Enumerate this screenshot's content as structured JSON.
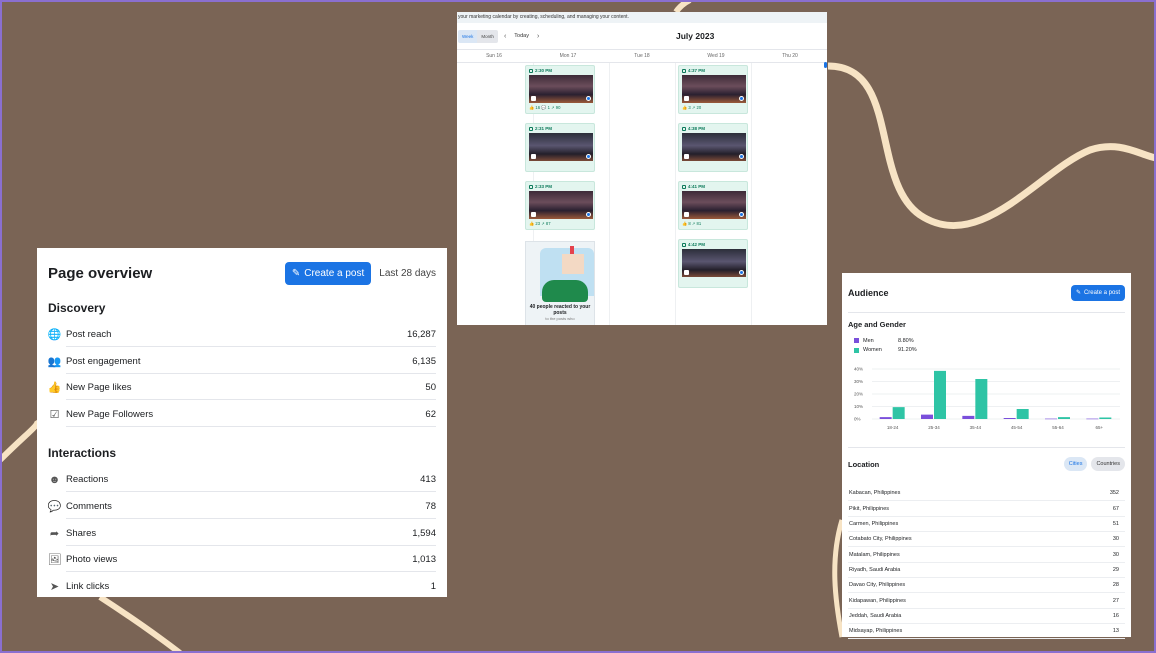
{
  "colors": {
    "background": "#7a6455",
    "accent": "#1b74e4",
    "men": "#7a4fdb",
    "women": "#2ec4a5",
    "post_green": "#0c7a5a"
  },
  "overview": {
    "title": "Page overview",
    "create_post_label": "Create a post",
    "date_range": "Last 28 days",
    "discovery": {
      "heading": "Discovery",
      "rows": [
        {
          "icon": "globe-icon",
          "label": "Post reach",
          "value": "16,287"
        },
        {
          "icon": "people-icon",
          "label": "Post engagement",
          "value": "6,135"
        },
        {
          "icon": "thumbs-up-icon",
          "label": "New Page likes",
          "value": "50"
        },
        {
          "icon": "check-box-icon",
          "label": "New Page Followers",
          "value": "62"
        }
      ]
    },
    "interactions": {
      "heading": "Interactions",
      "rows": [
        {
          "icon": "smiley-icon",
          "label": "Reactions",
          "value": "413"
        },
        {
          "icon": "comment-icon",
          "label": "Comments",
          "value": "78"
        },
        {
          "icon": "share-icon",
          "label": "Shares",
          "value": "1,594"
        },
        {
          "icon": "photo-icon",
          "label": "Photo views",
          "value": "1,013"
        },
        {
          "icon": "cursor-icon",
          "label": "Link clicks",
          "value": "1"
        }
      ]
    }
  },
  "calendar": {
    "banner": "your marketing calendar by creating, scheduling, and managing your content.",
    "view_week": "Week",
    "view_month": "Month",
    "today_label": "Today",
    "month_title": "July 2023",
    "days": [
      "Sun 16",
      "Mon 17",
      "Tue 18",
      "Wed 19",
      "Thu 20"
    ],
    "mon_posts": [
      {
        "time": "2:30 PM",
        "stats": "👍 16  💬 1  ↗ 90"
      },
      {
        "time": "2:31 PM",
        "stats": ""
      },
      {
        "time": "2:33 PM",
        "stats": "👍 23  ↗ 87"
      }
    ],
    "wed_posts": [
      {
        "time": "4:37 PM",
        "stats": "👍 3  ↗ 20"
      },
      {
        "time": "4:38 PM",
        "stats": ""
      },
      {
        "time": "4:41 PM",
        "stats": "👍 8  ↗ 81"
      },
      {
        "time": "4:42 PM",
        "stats": ""
      }
    ],
    "promo_title": "40 people reacted to your posts",
    "promo_sub": "to the posts who"
  },
  "audience": {
    "title": "Audience",
    "create_post_label": "Create a post",
    "age_gender_heading": "Age and Gender",
    "legend": [
      {
        "label": "Men",
        "value": "8.80%"
      },
      {
        "label": "Women",
        "value": "91.20%"
      }
    ],
    "location_heading": "Location",
    "tab_cities": "Cities",
    "tab_countries": "Countries",
    "locations": [
      {
        "name": "Kabacan, Philippines",
        "value": "352"
      },
      {
        "name": "Pikit, Philippines",
        "value": "67"
      },
      {
        "name": "Carmen, Philippines",
        "value": "51"
      },
      {
        "name": "Cotabato City, Philippines",
        "value": "30"
      },
      {
        "name": "Matalam, Philippines",
        "value": "30"
      },
      {
        "name": "Riyadh, Saudi Arabia",
        "value": "29"
      },
      {
        "name": "Davao City, Philippines",
        "value": "28"
      },
      {
        "name": "Kidapawan, Philippines",
        "value": "27"
      },
      {
        "name": "Jeddah, Saudi Arabia",
        "value": "16"
      },
      {
        "name": "Midsayap, Philippines",
        "value": "13"
      }
    ]
  },
  "chart_data": {
    "type": "bar",
    "categories": [
      "18-24",
      "25-34",
      "35-44",
      "45-54",
      "55-64",
      "65+"
    ],
    "series": [
      {
        "name": "Men",
        "values": [
          1.5,
          3.5,
          2.5,
          0.8,
          0.3,
          0.3
        ]
      },
      {
        "name": "Women",
        "values": [
          9.5,
          38.5,
          32,
          8,
          1.5,
          1.2
        ]
      }
    ],
    "yticks": [
      "40%",
      "30%",
      "20%",
      "10%",
      "0%"
    ],
    "ylim": [
      0,
      40
    ],
    "grid": true
  }
}
